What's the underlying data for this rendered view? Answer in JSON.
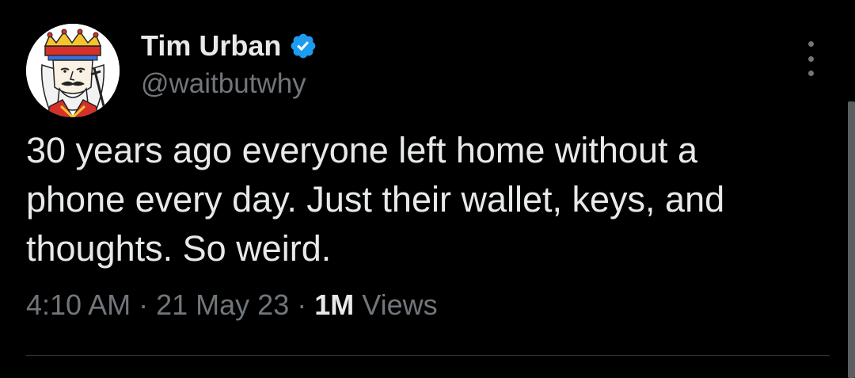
{
  "tweet": {
    "author": {
      "display_name": "Tim Urban",
      "handle": "@waitbutwhy",
      "verified_icon": "verified-badge-icon",
      "avatar_icon": "king-card-avatar"
    },
    "text": "30 years ago everyone left home without a\nphone every day. Just their wallet, keys, and\nthoughts. So weird.",
    "time": "4:10 AM",
    "date": "21 May 23",
    "separator": "·",
    "views_count": "1M",
    "views_label": "Views",
    "more_icon": "more-options-icon"
  },
  "colors": {
    "background": "#000000",
    "primary_text": "#e7e9ea",
    "secondary_text": "#71767b",
    "verified_blue": "#1d9bf0",
    "divider": "#2f3336"
  }
}
